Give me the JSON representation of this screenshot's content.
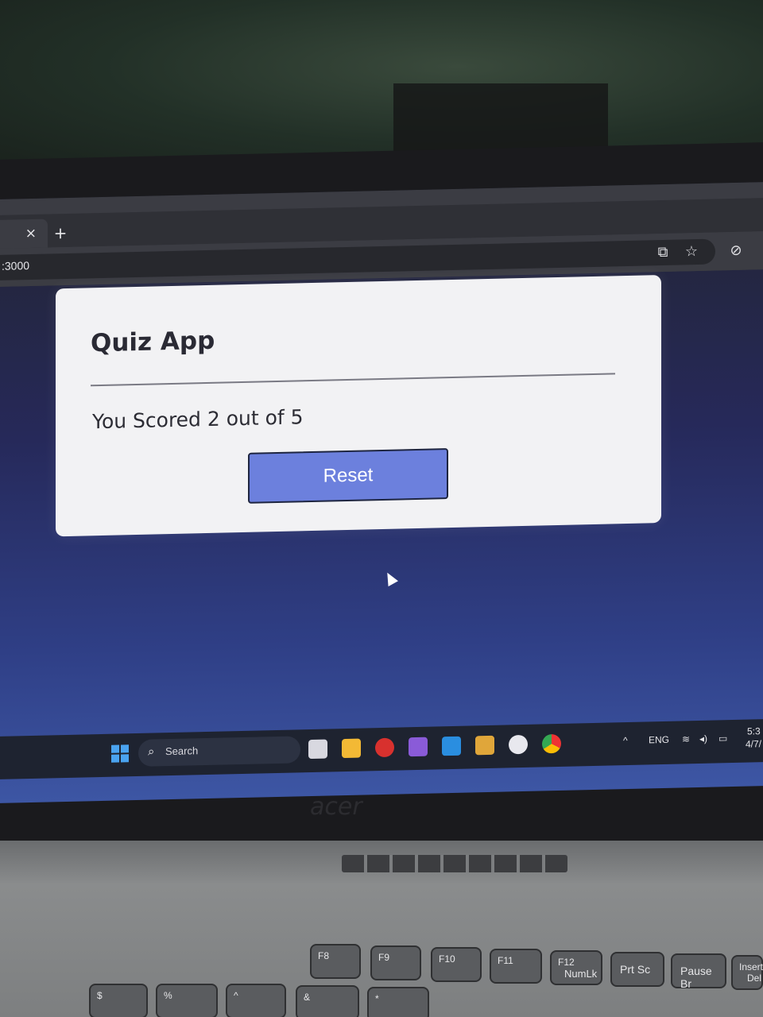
{
  "browser": {
    "tab_close": "×",
    "new_tab": "+",
    "address": ":3000"
  },
  "quiz": {
    "title": "Quiz App",
    "score_text": "You Scored 2 out of 5",
    "reset_label": "Reset"
  },
  "taskbar": {
    "search_label": "Search",
    "language": "ENG",
    "time": "5:3",
    "date": "4/7/"
  },
  "laptop": {
    "brand": "acer",
    "keys": {
      "f8": "F8",
      "f9": "F9",
      "f10": "F10",
      "f11": "F11",
      "f12_top": "F12",
      "f12_bottom": "NumLk",
      "prtsc": "Prt Sc",
      "pause": "Pause Br",
      "insert_top": "Insert",
      "insert_bottom": "Del",
      "percent": "%",
      "ampersand": "&",
      "star": "*",
      "caret": "^",
      "dollar": "$"
    }
  },
  "colors": {
    "reset_button": "#6c80dd",
    "card_bg": "#f2f2f4",
    "screen_bg": "#2f3f86"
  }
}
